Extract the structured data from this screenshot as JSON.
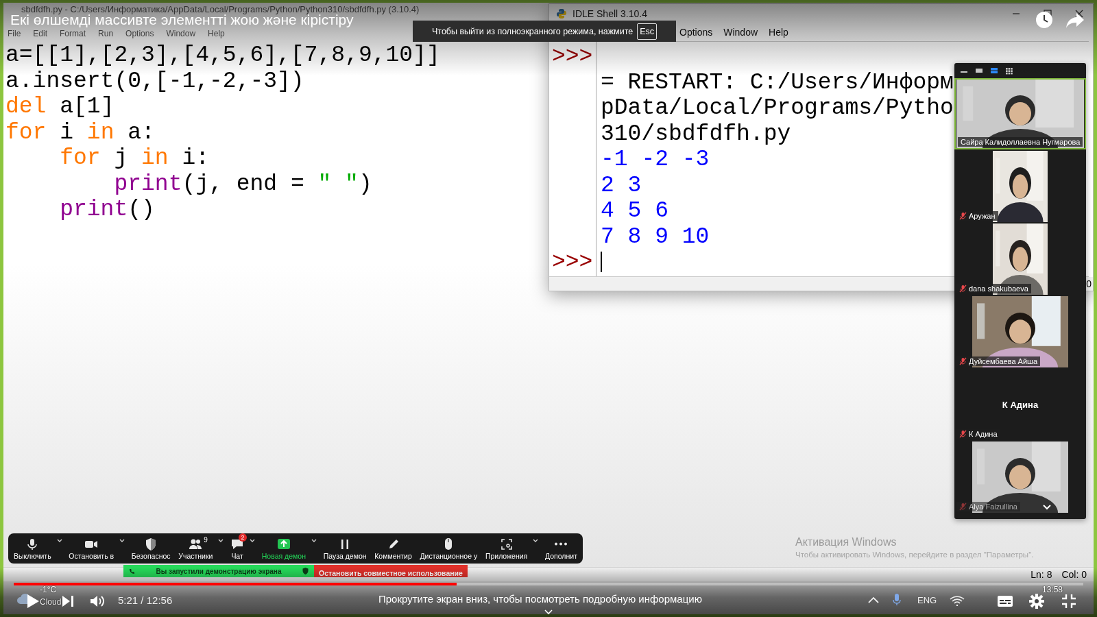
{
  "video": {
    "title": "Екі өлшемді массивте элементті жою және кірістіру",
    "fullscreen_hint": "Чтобы выйти из полноэкранного режима, нажмите",
    "fullscreen_key": "Esc",
    "progress": {
      "level": 0.414
    },
    "time": "5:21 / 12:56",
    "scroll_hint": "Прокрутите экран вниз, чтобы посмотреть подробную информацию"
  },
  "editor": {
    "title": "sbdfdfh.py - C:/Users/Информатика/AppData/Local/Programs/Python/Python310/sbdfdfh.py (3.10.4)",
    "menu": [
      "File",
      "Edit",
      "Format",
      "Run",
      "Options",
      "Window",
      "Help"
    ],
    "lines": [
      [
        {
          "kind": "plain",
          "text": "a=[[1],[2,3],[4,5,6],[7,8,9,10]]"
        }
      ],
      [
        {
          "kind": "plain",
          "text": "a.insert(0,[-1,-2,-3])"
        }
      ],
      [
        {
          "kind": "keyword",
          "text": "del"
        },
        {
          "kind": "plain",
          "text": " a[1]"
        }
      ],
      [
        {
          "kind": "keyword",
          "text": "for"
        },
        {
          "kind": "plain",
          "text": " i "
        },
        {
          "kind": "keyword",
          "text": "in"
        },
        {
          "kind": "plain",
          "text": " a:"
        }
      ],
      [
        {
          "kind": "keyword",
          "text": "    for"
        },
        {
          "kind": "plain",
          "text": " j "
        },
        {
          "kind": "keyword",
          "text": "in"
        },
        {
          "kind": "plain",
          "text": " i:"
        }
      ],
      [
        {
          "kind": "builtin",
          "text": "        print"
        },
        {
          "kind": "plain",
          "text": "(j, end = "
        },
        {
          "kind": "string",
          "text": "\" \""
        },
        {
          "kind": "plain",
          "text": ")"
        }
      ],
      [
        {
          "kind": "builtin",
          "text": "    print"
        },
        {
          "kind": "plain",
          "text": "()"
        }
      ]
    ],
    "status": [
      "Ln: 8",
      "Col: 0"
    ]
  },
  "shell": {
    "title": "IDLE Shell 3.10.4",
    "menu": [
      "Options",
      "Window",
      "Help"
    ],
    "rows": [
      {
        "prompt": ">>>"
      },
      {
        "kind": "plain",
        "text": "= RESTART: C:/Users/Информ"
      },
      {
        "kind": "plain",
        "text": "pData/Local/Programs/Pytho"
      },
      {
        "kind": "plain",
        "text": "310/sbdfdfh.py"
      },
      {
        "kind": "output",
        "text": "-1 -2 -3"
      },
      {
        "kind": "output",
        "text": "2 3"
      },
      {
        "kind": "output",
        "text": "4 5 6"
      },
      {
        "kind": "output",
        "text": "7 8 9 10"
      },
      {
        "prompt": ">>>",
        "kind": "input"
      }
    ],
    "status": "0"
  },
  "zoom": {
    "view_modes": [
      {
        "selected": false
      },
      {
        "selected": true
      },
      {
        "selected": false
      }
    ],
    "participants": [
      {
        "kind": "video",
        "name": "Сайра Калидоллаевна Нугмарова",
        "muted": false,
        "active": true
      },
      {
        "kind": "video",
        "name": "Аружан",
        "muted": true,
        "active": false
      },
      {
        "kind": "video",
        "name": "dana shakubaeva",
        "muted": true,
        "active": false
      },
      {
        "kind": "video",
        "name": "Дуйсембаева Айша",
        "muted": true,
        "active": false
      },
      {
        "kind": "name",
        "display_name": "К Адина",
        "name": "К Адина",
        "muted": true,
        "active": false
      },
      {
        "kind": "video",
        "name": "Alya Faizullina",
        "muted": true,
        "active": false
      }
    ],
    "toolbar": [
      {
        "label": "Выключить",
        "caret": true,
        "highlighted": false
      },
      {
        "label": "Остановить в",
        "caret": true,
        "highlighted": false
      },
      {
        "label": "Безопаснос",
        "caret": false,
        "highlighted": false
      },
      {
        "label": "Участники",
        "count": "9",
        "caret": true,
        "highlighted": false
      },
      {
        "label": "Чат",
        "badge": "2",
        "caret": true,
        "highlighted": false
      },
      {
        "label": "Новая демон",
        "caret": true,
        "highlighted": true
      },
      {
        "label": "Пауза демон",
        "caret": false,
        "highlighted": false
      },
      {
        "label": "Комментир",
        "caret": false,
        "highlighted": false
      },
      {
        "label": "Дистанционное у",
        "caret": false,
        "highlighted": false
      },
      {
        "label": "Приложения",
        "caret": true,
        "highlighted": false
      },
      {
        "label": "Дополнит",
        "caret": false,
        "highlighted": false
      }
    ],
    "banner": {
      "sharing": "Вы запустили демонстрацию экрана",
      "stop": "Остановить совместное использование"
    }
  },
  "desktop": {
    "activation_title": "Активация Windows",
    "activation_text": "Чтобы активировать Windows, перейдите в раздел \"Параметры\".",
    "weather_temp": "-1°C",
    "weather_text": "Cloud",
    "language": "ENG",
    "clock": "13:58"
  }
}
